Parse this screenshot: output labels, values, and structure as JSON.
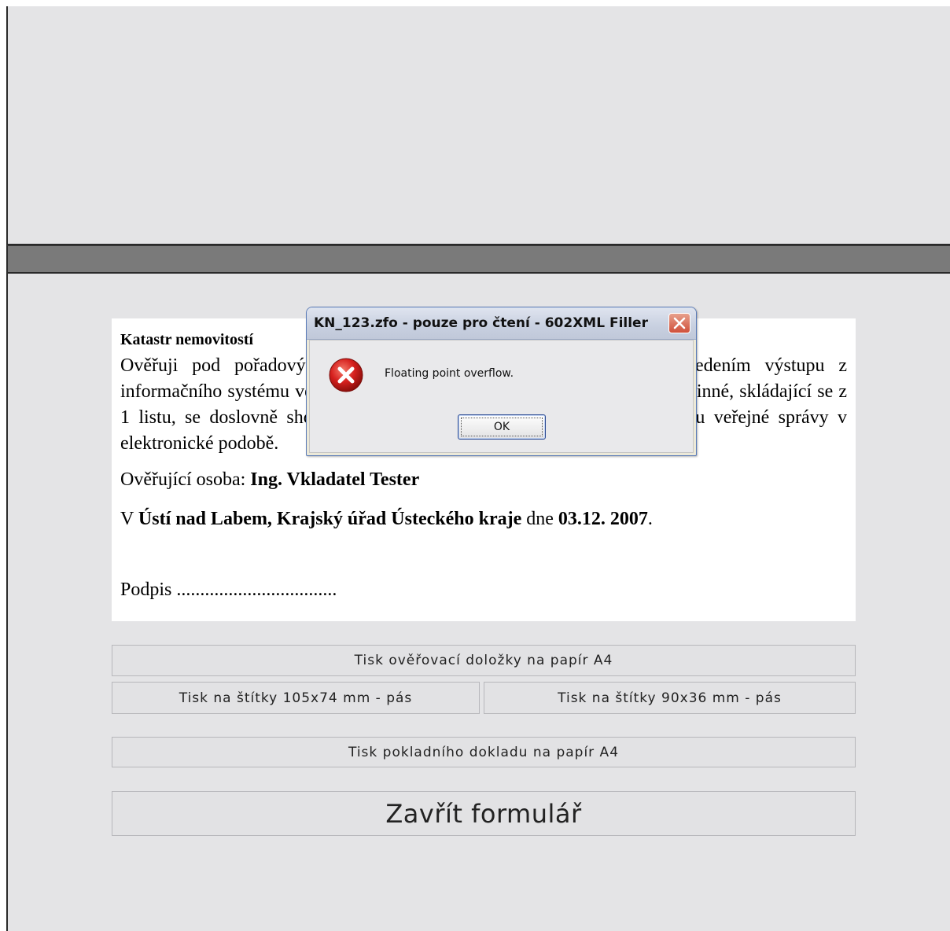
{
  "document": {
    "title": "Katastr nemovitostí",
    "paragraph": "Ověřuji pod pořadovým číslem, že tato listina, která vznikla převedením výstupu z informačního systému veřejné správy z elektronické podoby do podoby listinné, skládající se z 1 listu, se doslovně shoduje s obsahem výstupu z informačního systému veřejné správy v elektronické podobě.",
    "verifier_label": "Ověřující osoba: ",
    "verifier_name": "Ing.  Vkladatel  Tester",
    "place_prefix": "V ",
    "place": "Ústí nad Labem, Krajský úřad Ústeckého kraje",
    "date_prefix": " dne ",
    "date": "03.12. 2007",
    "date_suffix": ".",
    "signature": "Podpis .................................."
  },
  "buttons": {
    "print_a4": "Tisk ověřovací doložky na papír A4",
    "labels_105": "Tisk na štítky 105x74 mm - pás",
    "labels_90": "Tisk na štítky 90x36 mm - pás",
    "receipt_a4": "Tisk pokladního dokladu na papír A4",
    "close_form": "Zavřít formulář"
  },
  "dialog": {
    "title": "KN_123.zfo - pouze pro čtení - 602XML Filler",
    "message": "Floating point overflow.",
    "ok_label": "OK",
    "icon": "error-icon",
    "close_icon": "close-icon"
  },
  "colors": {
    "panel_bg": "#e4e4e6",
    "bar": "#7a7a7a",
    "error_red": "#d6201e"
  }
}
